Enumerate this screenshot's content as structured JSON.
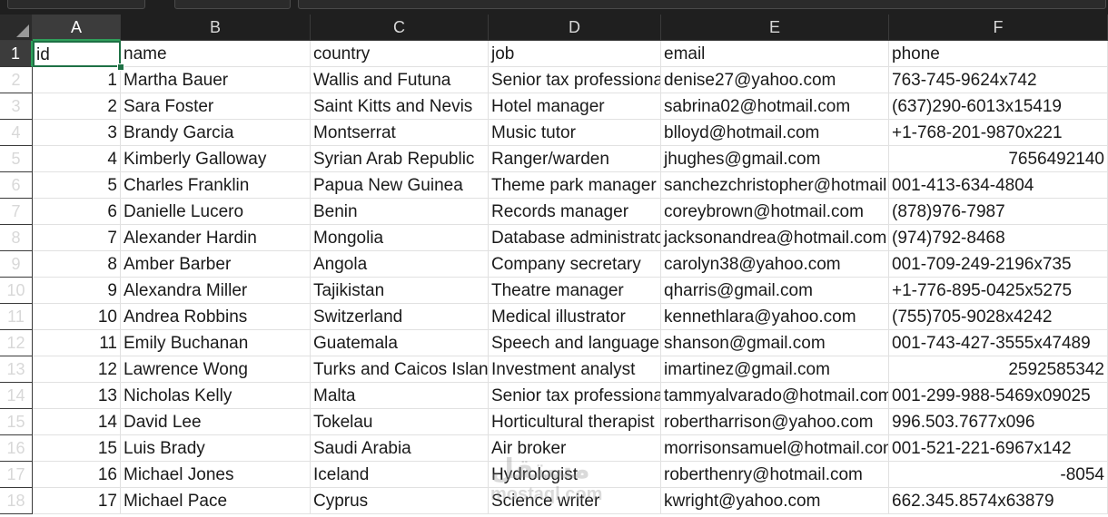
{
  "columns": [
    "A",
    "B",
    "C",
    "D",
    "E",
    "F"
  ],
  "rows": [
    "1",
    "2",
    "3",
    "4",
    "5",
    "6",
    "7",
    "8",
    "9",
    "10",
    "11",
    "12",
    "13",
    "14",
    "15",
    "16",
    "17",
    "18"
  ],
  "header_row": [
    "id",
    "name",
    "country",
    "job",
    "email",
    "phone"
  ],
  "data": [
    [
      "1",
      "Martha Bauer",
      "Wallis and Futuna",
      "Senior tax professional",
      "denise27@yahoo.com",
      "763-745-9624x742"
    ],
    [
      "2",
      "Sara Foster",
      "Saint Kitts and Nevis",
      "Hotel manager",
      "sabrina02@hotmail.com",
      "(637)290-6013x15419"
    ],
    [
      "3",
      "Brandy Garcia",
      "Montserrat",
      "Music tutor",
      "blloyd@hotmail.com",
      "+1-768-201-9870x221"
    ],
    [
      "4",
      "Kimberly Galloway",
      "Syrian Arab Republic",
      "Ranger/warden",
      "jhughes@gmail.com",
      "7656492140"
    ],
    [
      "5",
      "Charles Franklin",
      "Papua New Guinea",
      "Theme park manager",
      "sanchezchristopher@hotmail.com",
      "001-413-634-4804"
    ],
    [
      "6",
      "Danielle Lucero",
      "Benin",
      "Records manager",
      "coreybrown@hotmail.com",
      "(878)976-7987"
    ],
    [
      "7",
      "Alexander Hardin",
      "Mongolia",
      "Database administrator",
      "jacksonandrea@hotmail.com",
      "(974)792-8468"
    ],
    [
      "8",
      "Amber Barber",
      "Angola",
      "Company secretary",
      "carolyn38@yahoo.com",
      "001-709-249-2196x735"
    ],
    [
      "9",
      "Alexandra Miller",
      "Tajikistan",
      "Theatre manager",
      "qharris@gmail.com",
      "+1-776-895-0425x5275"
    ],
    [
      "10",
      "Andrea Robbins",
      "Switzerland",
      "Medical illustrator",
      "kennethlara@yahoo.com",
      "(755)705-9028x4242"
    ],
    [
      "11",
      "Emily Buchanan",
      "Guatemala",
      "Speech and language therapist",
      "shanson@gmail.com",
      "001-743-427-3555x47489"
    ],
    [
      "12",
      "Lawrence Wong",
      "Turks and Caicos Islands",
      "Investment analyst",
      "imartinez@gmail.com",
      "2592585342"
    ],
    [
      "13",
      "Nicholas Kelly",
      "Malta",
      "Senior tax professional",
      "tammyalvarado@hotmail.com",
      "001-299-988-5469x09025"
    ],
    [
      "14",
      "David Lee",
      "Tokelau",
      "Horticultural therapist",
      "robertharrison@yahoo.com",
      "996.503.7677x096"
    ],
    [
      "15",
      "Luis Brady",
      "Saudi Arabia",
      "Air broker",
      "morrisonsamuel@hotmail.com",
      "001-521-221-6967x142"
    ],
    [
      "16",
      "Michael Jones",
      "Iceland",
      "Hydrologist",
      "roberthenry@hotmail.com",
      "-8054"
    ],
    [
      "17",
      "Michael Pace",
      "Cyprus",
      "Science writer",
      "kwright@yahoo.com",
      "662.345.8574x63879"
    ]
  ],
  "numeric_phone_rows": [
    3,
    11,
    15
  ],
  "active_cell": "A1",
  "watermark": {
    "top": "مستقل",
    "bottom": "mostaql.com"
  },
  "colors": {
    "header_bg": "#1f1f1f",
    "header_text": "#d8d8d8",
    "selection_green": "#1e7145",
    "gridline": "#e1e1e1"
  }
}
